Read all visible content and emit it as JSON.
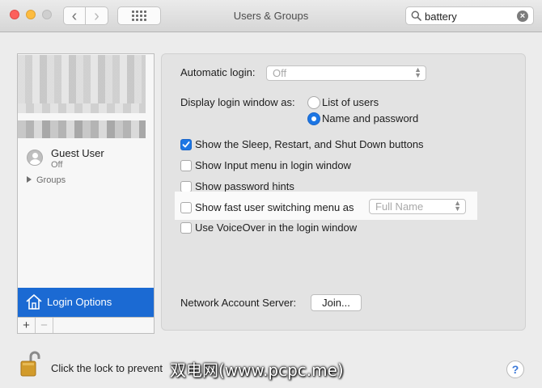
{
  "window": {
    "title": "Users & Groups"
  },
  "search": {
    "value": "battery"
  },
  "toolbar": {
    "back_icon": "chevron-left-icon",
    "forward_icon": "chevron-right-icon",
    "grid_icon": "show-all-grid-icon",
    "back_glyph": "‹",
    "forward_glyph": "›"
  },
  "sidebar": {
    "guest": {
      "name": "Guest User",
      "status": "Off"
    },
    "groups_label": "Groups",
    "login_options_label": "Login Options",
    "plus_label": "+",
    "minus_label": "−"
  },
  "main": {
    "automatic_login": {
      "label": "Automatic login:",
      "value": "Off"
    },
    "display_login": {
      "label": "Display login window as:",
      "options": [
        {
          "label": "List of users",
          "selected": false
        },
        {
          "label": "Name and password",
          "selected": true
        }
      ]
    },
    "checkboxes": [
      {
        "label": "Show the Sleep, Restart, and Shut Down buttons",
        "checked": true
      },
      {
        "label": "Show Input menu in login window",
        "checked": false
      },
      {
        "label": "Show password hints",
        "checked": false
      },
      {
        "label": "Show fast user switching menu as",
        "checked": false
      },
      {
        "label": "Use VoiceOver in the login window",
        "checked": false
      }
    ],
    "fast_switching_value": "Full Name",
    "network_account": {
      "label": "Network Account Server:",
      "button": "Join..."
    }
  },
  "footer": {
    "lock_text": "Click the lock to prevent",
    "help_label": "?",
    "watermark": "双电网(www.pcpc.me)"
  },
  "colors": {
    "accent": "#1c76e4",
    "selection": "#1b6ad3"
  }
}
